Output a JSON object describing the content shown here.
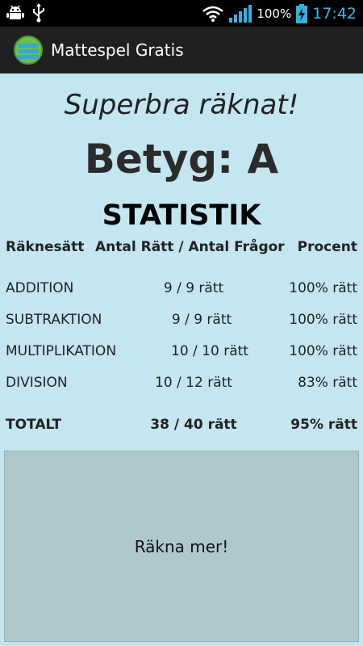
{
  "status_bar": {
    "battery_percent": "100%",
    "time": "17:42",
    "icons": [
      "android-debug-icon",
      "usb-icon",
      "wifi-icon",
      "signal-icon",
      "battery-charging-icon"
    ]
  },
  "action_bar": {
    "title": "Mattespel Gratis",
    "icon": "app-logo-icon"
  },
  "result": {
    "message": "Superbra räknat!",
    "grade": "Betyg: A"
  },
  "statistics": {
    "title": "STATISTIK",
    "headers": [
      "Räknesätt",
      "Antal Rätt / Antal Frågor",
      "Procent"
    ],
    "rows": [
      [
        "ADDITION",
        "9 / 9 rätt",
        "100% rätt"
      ],
      [
        "SUBTRAKTION",
        "9 / 9 rätt",
        "100% rätt"
      ],
      [
        "MULTIPLIKATION",
        "10 / 10 rätt",
        "100% rätt"
      ],
      [
        "DIVISION",
        "10 / 12 rätt",
        "83% rätt"
      ]
    ],
    "total": [
      "TOTALT",
      "38 / 40 rätt",
      "95% rätt"
    ]
  },
  "button": {
    "label": "Räkna mer!"
  },
  "colors": {
    "background": "#c3e6f1",
    "action_bar": "#202020",
    "button": "#aec8cc",
    "clock": "#3ab9e6"
  }
}
